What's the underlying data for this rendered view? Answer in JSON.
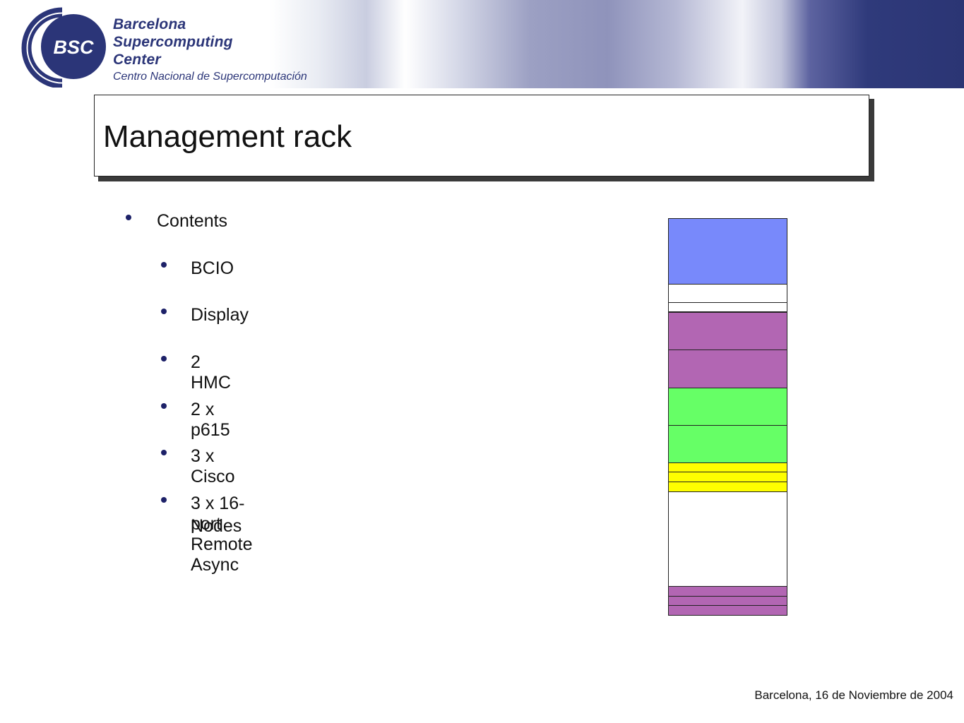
{
  "header": {
    "logo_abbr": "BSC",
    "logo_lines": [
      "Barcelona",
      "Supercomputing",
      "Center"
    ],
    "logo_subtitle": "Centro Nacional de Supercomputación",
    "brand_color": "#2b3578"
  },
  "slide": {
    "title": "Management rack",
    "bullet_top": "Contents",
    "sub_bullets": [
      "BCIO",
      "Display",
      "2 HMC",
      "2 x p615",
      "3 x Cisco",
      "3 x 16-port Remote Async",
      "Nodes"
    ]
  },
  "rack_diagram": {
    "slots": [
      {
        "component": "BCIO",
        "color": "#7889fb"
      },
      {
        "component": "Display",
        "color": "#ffffff"
      },
      {
        "component": "Display",
        "color": "#ffffff"
      },
      {
        "component": "HMC",
        "color": "#b266b3"
      },
      {
        "component": "HMC",
        "color": "#b266b3"
      },
      {
        "component": "p615",
        "color": "#66ff66"
      },
      {
        "component": "p615",
        "color": "#66ff66"
      },
      {
        "component": "Cisco",
        "color": "#ffff00"
      },
      {
        "component": "Cisco",
        "color": "#ffff00"
      },
      {
        "component": "Cisco",
        "color": "#ffff00"
      },
      {
        "component": "empty",
        "color": "#ffffff"
      },
      {
        "component": "Remote Async Node",
        "color": "#b266b3"
      },
      {
        "component": "Remote Async Node",
        "color": "#b266b3"
      },
      {
        "component": "Remote Async Node",
        "color": "#b266b3"
      }
    ]
  },
  "footer": {
    "text": "Barcelona, 16 de Noviembre de 2004"
  }
}
